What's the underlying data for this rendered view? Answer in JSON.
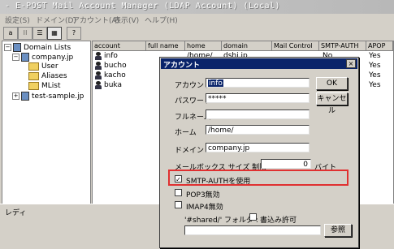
{
  "window": {
    "title": "- E-POST Mail Account Manager (LDAP Account) (Local)"
  },
  "menu": [
    {
      "label": "設定(S)"
    },
    {
      "label": "ドメイン(D)"
    },
    {
      "label": "アカウント(A)"
    },
    {
      "label": "表示(V)"
    },
    {
      "label": "ヘルプ(H)"
    }
  ],
  "toolbar": {
    "b1": "a",
    "b2": "⁝⁝",
    "b3": "☰",
    "b4": "▦",
    "b5": "?"
  },
  "tree": {
    "root": "Domain Lists",
    "domain1": "company.jp",
    "user": "User",
    "aliases": "Aliases",
    "mlist": "MList",
    "domain2": "test-sample.jp"
  },
  "list": {
    "headers": [
      "account",
      "full name",
      "home",
      "domain",
      "Mail Control",
      "SMTP-AUTH",
      "APOP"
    ],
    "rows": [
      {
        "account": "info",
        "home": "/home/",
        "domain": "dshi.jp",
        "smtp": "No",
        "apop": "Yes"
      },
      {
        "account": "bucho",
        "home": "",
        "domain": "",
        "smtp": "",
        "apop": "Yes"
      },
      {
        "account": "kacho",
        "home": "",
        "domain": "",
        "smtp": "",
        "apop": "Yes"
      },
      {
        "account": "buka",
        "home": "",
        "domain": "",
        "smtp": "",
        "apop": "Yes"
      }
    ]
  },
  "status": "レディ",
  "dialog": {
    "title": "アカウント",
    "close": "×",
    "account_label": "アカウント",
    "account_value": "info",
    "password_label": "パスワード",
    "password_value": "*****",
    "fullname_label": "フルネーム",
    "fullname_value": "",
    "home_label": "ホーム",
    "home_value": "/home/",
    "domain_label": "ドメイン",
    "domain_value": "company.jp",
    "mailbox_label": "メールボックス サイズ 制限",
    "mailbox_value": "0",
    "mailbox_unit": "バイト",
    "ok": "OK",
    "cancel": "キャンセル",
    "smtp_auth": "SMTP-AUTHを使用",
    "smtp_checked": "✓",
    "pop3": "POP3無効",
    "imap4": "IMAP4無効",
    "shared_label": "'#shared/' フォルダ :",
    "write_perm": "書込み許可",
    "browse": "参照"
  }
}
